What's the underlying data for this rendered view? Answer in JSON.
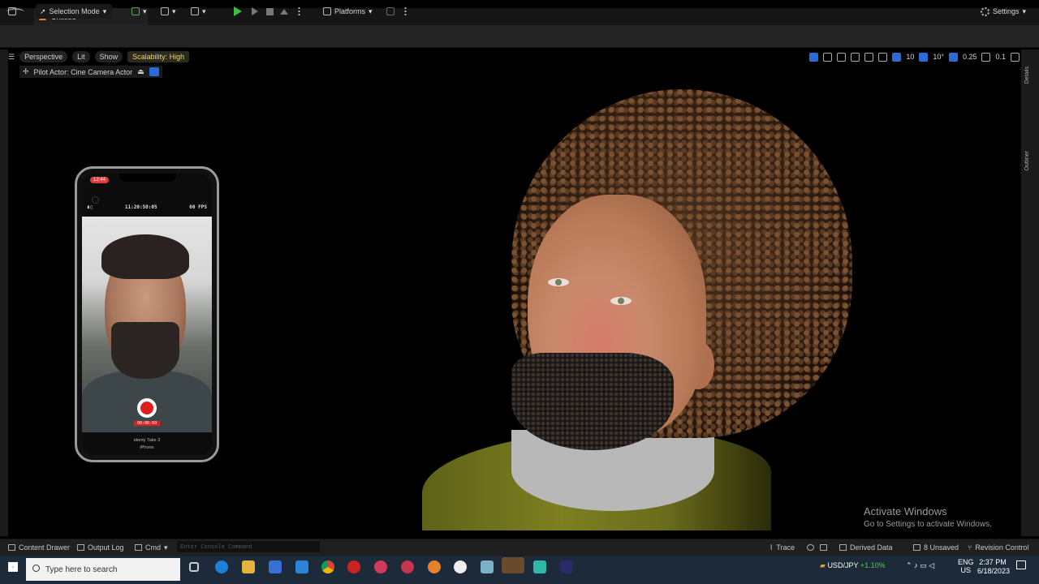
{
  "window": {
    "tab_title": "Untitled*"
  },
  "toolbar": {
    "selection_mode": "Selection Mode",
    "platforms": "Platforms",
    "settings": "Settings"
  },
  "viewport": {
    "perspective": "Perspective",
    "lit": "Lit",
    "show": "Show",
    "scalability": "Scalability: High",
    "grid_snap": "10",
    "rotation_snap": "10°",
    "scale_snap": "0.25",
    "camera_speed": "0.1",
    "pilot_actor": "Pilot Actor: Cine Camera Actor"
  },
  "side_panels": {
    "details": "Details",
    "outliner": "Outliner"
  },
  "phone": {
    "clock": "12:44",
    "timecode": "11:20:58:05",
    "fps": "60 FPS",
    "record_time": "00:00:09",
    "take_name": "identy Take 3",
    "device": "iPhone"
  },
  "watermark": {
    "title": "Activate Windows",
    "subtitle": "Go to Settings to activate Windows."
  },
  "statusbar": {
    "content_drawer": "Content Drawer",
    "output_log": "Output Log",
    "cmd": "Cmd",
    "console_placeholder": "Enter Console Command",
    "trace": "Trace",
    "derived_data": "Derived Data",
    "unsaved": "8 Unsaved",
    "revision_control": "Revision Control"
  },
  "taskbar": {
    "search_placeholder": "Type here to search",
    "ticker_symbol": "USD/JPY",
    "ticker_change": "+1.10%",
    "lang": "ENG",
    "region": "US",
    "time": "2:37 PM",
    "date": "6/18/2023"
  },
  "colors": {
    "accent_blue": "#2a6bd6",
    "play_green": "#3fbf3f",
    "record_red": "#e01d1d",
    "scalability_yellow": "#f0d66a"
  }
}
